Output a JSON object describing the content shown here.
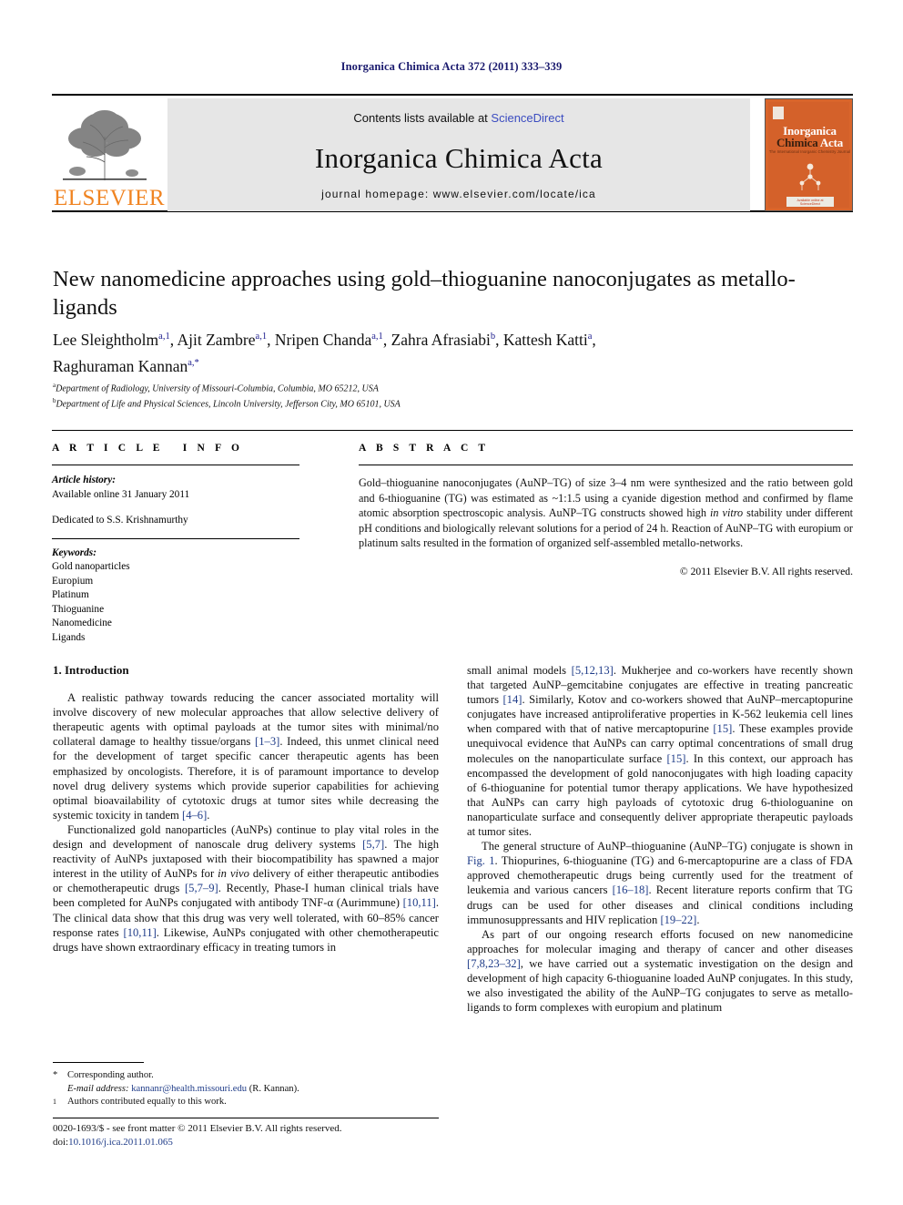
{
  "running_head": "Inorganica Chimica Acta 372 (2011) 333–339",
  "masthead": {
    "contents_prefix": "Contents lists available at ",
    "sciencedirect": "ScienceDirect",
    "journal_name": "Inorganica Chimica Acta",
    "homepage": "journal homepage: www.elsevier.com/locate/ica",
    "publisher_wordmark": "ELSEVIER",
    "cover": {
      "title_line1": "Inorganica",
      "title_line2a": "Chimica",
      "title_line2b": "Acta",
      "subtitle": "The International Inorganic Chemistry Journal",
      "badge": "Available online at ScienceDirect"
    },
    "accent_orange": "#f08422",
    "link_blue": "#3b4cc0",
    "cover_orange": "#d4612a"
  },
  "article": {
    "title": "New nanomedicine approaches using gold–thioguanine nanoconjugates as metallo-ligands",
    "authors_line1_parts": [
      {
        "name": "Lee Sleightholm",
        "sup": "a,1",
        "sep": ", "
      },
      {
        "name": "Ajit Zambre",
        "sup": "a,1",
        "sep": ", "
      },
      {
        "name": "Nripen Chanda",
        "sup": "a,1",
        "sep": ", "
      },
      {
        "name": "Zahra Afrasiabi",
        "sup": "b",
        "sep": ", "
      },
      {
        "name": "Kattesh Katti",
        "sup": "a",
        "sep": ","
      }
    ],
    "authors_line2": {
      "name": "Raghuraman Kannan",
      "sup": "a,*"
    },
    "affiliations": [
      {
        "mark": "a",
        "text": "Department of Radiology, University of Missouri-Columbia, Columbia, MO 65212, USA"
      },
      {
        "mark": "b",
        "text": "Department of Life and Physical Sciences, Lincoln University, Jefferson City, MO 65101, USA"
      }
    ]
  },
  "article_info": {
    "heading": "ARTICLE INFO",
    "history_label": "Article history:",
    "history_value": "Available online 31 January 2011",
    "dedication": "Dedicated to S.S. Krishnamurthy",
    "keywords_label": "Keywords:",
    "keywords": [
      "Gold nanoparticles",
      "Europium",
      "Platinum",
      "Thioguanine",
      "Nanomedicine",
      "Ligands"
    ]
  },
  "abstract": {
    "heading": "ABSTRACT",
    "paragraph_parts": [
      {
        "t": "Gold–thioguanine nanoconjugates (AuNP–TG) of size 3–4 nm were synthesized and the ratio between gold and 6-thioguanine (TG) was estimated as ~1:1.5 using a cyanide digestion method and confirmed by flame atomic absorption spectroscopic analysis. AuNP–TG constructs showed high ",
        "i": false
      },
      {
        "t": "in vitro",
        "i": true
      },
      {
        "t": " stability under different pH conditions and biologically relevant solutions for a period of 24 h. Reaction of AuNP–TG with europium or platinum salts resulted in the formation of organized self-assembled metallo-networks.",
        "i": false
      }
    ],
    "copyright": "© 2011 Elsevier B.V. All rights reserved."
  },
  "body": {
    "section_title": "1. Introduction",
    "left_paragraphs": [
      [
        {
          "t": "A realistic pathway towards reducing the cancer associated mortality will involve discovery of new molecular approaches that allow selective delivery of therapeutic agents with optimal payloads at the tumor sites with minimal/no collateral damage to healthy tissue/organs ",
          "k": "plain"
        },
        {
          "t": "[1–3]",
          "k": "ref"
        },
        {
          "t": ". Indeed, this unmet clinical need for the development of target specific cancer therapeutic agents has been emphasized by oncologists. Therefore, it is of paramount importance to develop novel drug delivery systems which provide superior capabilities for achieving optimal bioavailability of cytotoxic drugs at tumor sites while decreasing the systemic toxicity in tandem ",
          "k": "plain"
        },
        {
          "t": "[4–6]",
          "k": "ref"
        },
        {
          "t": ".",
          "k": "plain"
        }
      ],
      [
        {
          "t": "Functionalized gold nanoparticles (AuNPs) continue to play vital roles in the design and development of nanoscale drug delivery systems ",
          "k": "plain"
        },
        {
          "t": "[5,7]",
          "k": "ref"
        },
        {
          "t": ". The high reactivity of AuNPs juxtaposed with their biocompatibility has spawned a major interest in the utility of AuNPs for ",
          "k": "plain"
        },
        {
          "t": "in vivo",
          "k": "ital"
        },
        {
          "t": " delivery of either therapeutic antibodies or chemotherapeutic drugs ",
          "k": "plain"
        },
        {
          "t": "[5,7–9]",
          "k": "ref"
        },
        {
          "t": ". Recently, Phase-I human clinical trials have been completed for AuNPs conjugated with antibody TNF-α (Aurimmune) ",
          "k": "plain"
        },
        {
          "t": "[10,11]",
          "k": "ref"
        },
        {
          "t": ". The clinical data show that this drug was very well tolerated, with 60–85% cancer response rates ",
          "k": "plain"
        },
        {
          "t": "[10,11]",
          "k": "ref"
        },
        {
          "t": ". Likewise, AuNPs conjugated with other chemotherapeutic drugs have shown extraordinary efficacy in treating tumors in",
          "k": "plain"
        }
      ]
    ],
    "right_paragraphs": [
      [
        {
          "t": "small animal models ",
          "k": "plain"
        },
        {
          "t": "[5,12,13]",
          "k": "ref"
        },
        {
          "t": ". Mukherjee and co-workers have recently shown that targeted AuNP–gemcitabine conjugates are effective in treating pancreatic tumors ",
          "k": "plain"
        },
        {
          "t": "[14]",
          "k": "ref"
        },
        {
          "t": ". Similarly, Kotov and co-workers showed that AuNP–mercaptopurine conjugates have increased antiproliferative properties in K-562 leukemia cell lines when compared with that of native mercaptopurine ",
          "k": "plain"
        },
        {
          "t": "[15]",
          "k": "ref"
        },
        {
          "t": ". These examples provide unequivocal evidence that AuNPs can carry optimal concentrations of small drug molecules on the nanoparticulate surface ",
          "k": "plain"
        },
        {
          "t": "[15]",
          "k": "ref"
        },
        {
          "t": ". In this context, our approach has encompassed the development of gold nanoconjugates with high loading capacity of 6-thioguanine for potential tumor therapy applications. We have hypothesized that AuNPs can carry high payloads of cytotoxic drug 6-thiologuanine on nanoparticulate surface and consequently deliver appropriate therapeutic payloads at tumor sites.",
          "k": "plain"
        }
      ],
      [
        {
          "t": "The general structure of AuNP–thioguanine (AuNP–TG) conjugate is shown in ",
          "k": "plain"
        },
        {
          "t": "Fig. 1",
          "k": "ref"
        },
        {
          "t": ". Thiopurines, 6-thioguanine (TG) and 6-mercaptopurine are a class of FDA approved chemotherapeutic drugs being currently used for the treatment of leukemia and various cancers ",
          "k": "plain"
        },
        {
          "t": "[16–18]",
          "k": "ref"
        },
        {
          "t": ". Recent literature reports confirm that TG drugs can be used for other diseases and clinical conditions including immunosuppressants and HIV replication ",
          "k": "plain"
        },
        {
          "t": "[19–22]",
          "k": "ref"
        },
        {
          "t": ".",
          "k": "plain"
        }
      ],
      [
        {
          "t": "As part of our ongoing research efforts focused on new nanomedicine approaches for molecular imaging and therapy of cancer and other diseases ",
          "k": "plain"
        },
        {
          "t": "[7,8,23–32]",
          "k": "ref"
        },
        {
          "t": ", we have carried out a systematic investigation on the design and development of high capacity 6-thioguanine loaded AuNP conjugates. In this study, we also investigated the ability of the AuNP–TG conjugates to serve as metallo-ligands to form complexes with europium and platinum",
          "k": "plain"
        }
      ]
    ]
  },
  "footnotes": [
    {
      "mark": "*",
      "line1": "Corresponding author.",
      "label": "E-mail address:",
      "email": "kannanr@health.missouri.edu",
      "suffix": " (R. Kannan)."
    },
    {
      "mark": "1",
      "line1": "Authors contributed equally to this work."
    }
  ],
  "imprint": {
    "line1": "0020-1693/$ - see front matter © 2011 Elsevier B.V. All rights reserved.",
    "doi_label": "doi:",
    "doi_value": "10.1016/j.ica.2011.01.065"
  }
}
